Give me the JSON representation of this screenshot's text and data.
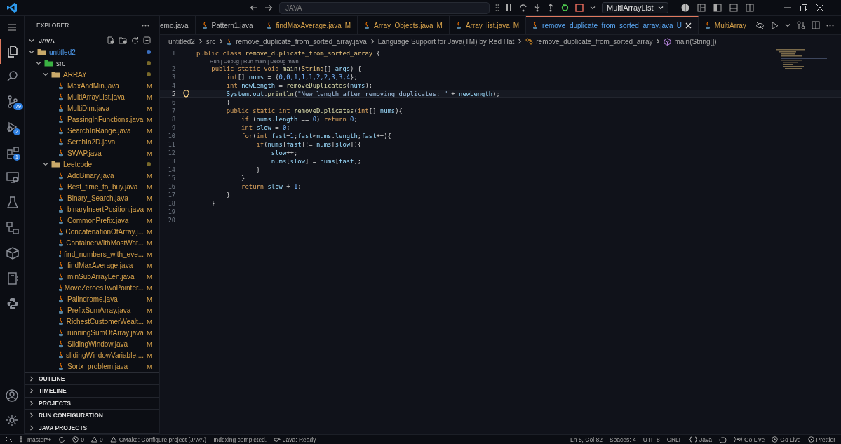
{
  "title_bar": {
    "search": "JAVA",
    "run_target": "MultiArrayList"
  },
  "activity_bar": [
    {
      "kind": "files",
      "selected": true
    },
    {
      "kind": "search",
      "selected": false
    },
    {
      "kind": "source-control",
      "selected": false,
      "badge": "79"
    },
    {
      "kind": "run-debug",
      "selected": false,
      "badge": "2"
    },
    {
      "kind": "extensions",
      "selected": false,
      "badge": "1"
    },
    {
      "kind": "remote",
      "selected": false
    },
    {
      "kind": "testing",
      "selected": false
    },
    {
      "kind": "diagram",
      "selected": false
    },
    {
      "kind": "package",
      "selected": false
    },
    {
      "kind": "book",
      "selected": false
    },
    {
      "kind": "python",
      "selected": false
    }
  ],
  "explorer": {
    "title": "EXPLORER",
    "section": "JAVA",
    "tree": [
      {
        "name": "untitled2",
        "kind": "folder",
        "untracked": true,
        "modified": false,
        "expanded": true,
        "children": [
          {
            "name": "src",
            "kind": "package",
            "untracked": false,
            "modified": false,
            "expanded": true,
            "children": [
              {
                "name": "ARRAY",
                "kind": "folder",
                "untracked": false,
                "modified": true,
                "expanded": true,
                "children": [
                  {
                    "name": "MaxAndMin.java",
                    "kind": "file",
                    "untracked": false,
                    "modified": true,
                    "badge": "M"
                  },
                  {
                    "name": "MultiArrayList.java",
                    "kind": "file",
                    "untracked": false,
                    "modified": true,
                    "badge": "M"
                  },
                  {
                    "name": "MultiDim.java",
                    "kind": "file",
                    "untracked": false,
                    "modified": true,
                    "badge": "M"
                  },
                  {
                    "name": "PassingInFunctions.java",
                    "kind": "file",
                    "untracked": false,
                    "modified": true,
                    "badge": "M"
                  },
                  {
                    "name": "SearchInRange.java",
                    "kind": "file",
                    "untracked": false,
                    "modified": true,
                    "badge": "M"
                  },
                  {
                    "name": "SerchIn2D.java",
                    "kind": "file",
                    "untracked": false,
                    "modified": true,
                    "badge": "M"
                  },
                  {
                    "name": "SWAP.java",
                    "kind": "file",
                    "untracked": false,
                    "modified": true,
                    "badge": "M"
                  }
                ]
              },
              {
                "name": "Leetcode",
                "kind": "folder",
                "untracked": false,
                "modified": true,
                "expanded": true,
                "children": [
                  {
                    "name": "AddBinary.java",
                    "kind": "file",
                    "untracked": false,
                    "modified": true,
                    "badge": "M"
                  },
                  {
                    "name": "Best_time_to_buy.java",
                    "kind": "file",
                    "untracked": false,
                    "modified": true,
                    "badge": "M"
                  },
                  {
                    "name": "Binary_Search.java",
                    "kind": "file",
                    "untracked": false,
                    "modified": true,
                    "badge": "M"
                  },
                  {
                    "name": "binaryInsertPosition.java",
                    "kind": "file",
                    "untracked": false,
                    "modified": true,
                    "badge": "M"
                  },
                  {
                    "name": "CommonPrefix.java",
                    "kind": "file",
                    "untracked": false,
                    "modified": true,
                    "badge": "M"
                  },
                  {
                    "name": "ConcatenationOfArray.j...",
                    "kind": "file",
                    "untracked": false,
                    "modified": true,
                    "badge": "M"
                  },
                  {
                    "name": "ContainerWithMostWat...",
                    "kind": "file",
                    "untracked": false,
                    "modified": true,
                    "badge": "M"
                  },
                  {
                    "name": "find_numbers_with_eve...",
                    "kind": "file",
                    "untracked": false,
                    "modified": true,
                    "badge": "M"
                  },
                  {
                    "name": "findMaxAverage.java",
                    "kind": "file",
                    "untracked": false,
                    "modified": true,
                    "badge": "M"
                  },
                  {
                    "name": "minSubArrayLen.java",
                    "kind": "file",
                    "untracked": false,
                    "modified": true,
                    "badge": "M"
                  },
                  {
                    "name": "MoveZeroesTwoPointer...",
                    "kind": "file",
                    "untracked": false,
                    "modified": true,
                    "badge": "M"
                  },
                  {
                    "name": "Palindrome.java",
                    "kind": "file",
                    "untracked": false,
                    "modified": true,
                    "badge": "M"
                  },
                  {
                    "name": "PrefixSumArray.java",
                    "kind": "file",
                    "untracked": false,
                    "modified": true,
                    "badge": "M"
                  },
                  {
                    "name": "RichestCustomerWealt...",
                    "kind": "file",
                    "untracked": false,
                    "modified": true,
                    "badge": "M"
                  },
                  {
                    "name": "runningSumOfArray.java",
                    "kind": "file",
                    "untracked": false,
                    "modified": true,
                    "badge": "M"
                  },
                  {
                    "name": "SlidingWindow.java",
                    "kind": "file",
                    "untracked": false,
                    "modified": true,
                    "badge": "M"
                  },
                  {
                    "name": "slidingWindowVariable....",
                    "kind": "file",
                    "untracked": false,
                    "modified": true,
                    "badge": "M"
                  },
                  {
                    "name": "Sortx_problem.java",
                    "kind": "file",
                    "untracked": false,
                    "modified": true,
                    "badge": "M"
                  }
                ]
              }
            ]
          }
        ]
      }
    ]
  },
  "panels": [
    "OUTLINE",
    "TIMELINE",
    "PROJECTS",
    "RUN CONFIGURATION",
    "JAVA PROJECTS"
  ],
  "tabs": [
    {
      "label": "emo.java",
      "modified": false,
      "selected": false
    },
    {
      "label": "Pattern1.java",
      "modified": false,
      "selected": false
    },
    {
      "label": "findMaxAverage.java",
      "modified": true,
      "badge": "M",
      "selected": false
    },
    {
      "label": "Array_Objects.java",
      "modified": true,
      "badge": "M",
      "selected": false
    },
    {
      "label": "Array_list.java",
      "modified": true,
      "badge": "M",
      "selected": false
    },
    {
      "label": "remove_duplicate_from_sorted_array.java",
      "modified": false,
      "badge": "U",
      "selected": true
    },
    {
      "label": "MultiArray",
      "modified": true,
      "selected": false
    }
  ],
  "breadcrumbs": [
    {
      "text": "untitled2",
      "kind": "folder"
    },
    {
      "text": "src",
      "kind": "folder"
    },
    {
      "text": "remove_duplicate_from_sorted_array.java",
      "kind": "file"
    },
    {
      "text": "Language Support for Java(TM) by Red Hat",
      "kind": "folder"
    },
    {
      "text": "remove_duplicate_from_sorted_array",
      "kind": "class"
    },
    {
      "text": "main(String[])",
      "kind": "method"
    }
  ],
  "editor": {
    "lines": [
      {
        "number": "1",
        "active": false,
        "tokens": [
          {
            "text": "public class ",
            "kind": "kw"
          },
          {
            "text": "remove_duplicate_from_sorted_array",
            "kind": "type"
          },
          {
            "text": " {",
            "kind": "punc"
          }
        ],
        "codelens": "Run | Debug | Run main | Debug main"
      },
      {
        "number": "2",
        "active": false,
        "tokens": [
          {
            "text": "    public static void ",
            "kind": "kw"
          },
          {
            "text": "main",
            "kind": "fn"
          },
          {
            "text": "(",
            "kind": "punc"
          },
          {
            "text": "String",
            "kind": "type"
          },
          {
            "text": "[] ",
            "kind": "punc"
          },
          {
            "text": "args",
            "kind": "var"
          },
          {
            "text": ") {",
            "kind": "punc"
          }
        ]
      },
      {
        "number": "3",
        "active": false,
        "tokens": [
          {
            "text": "        int",
            "kind": "kw"
          },
          {
            "text": "[] ",
            "kind": "punc"
          },
          {
            "text": "nums",
            "kind": "var"
          },
          {
            "text": " = {",
            "kind": "punc"
          },
          {
            "text": "0,0,1,1,1,2,2,3,3,4",
            "kind": "num"
          },
          {
            "text": "};",
            "kind": "punc"
          }
        ]
      },
      {
        "number": "4",
        "active": false,
        "tokens": [
          {
            "text": "        int ",
            "kind": "kw"
          },
          {
            "text": "newLength",
            "kind": "var"
          },
          {
            "text": " = ",
            "kind": "punc"
          },
          {
            "text": "removeDuplicates",
            "kind": "fn"
          },
          {
            "text": "(",
            "kind": "punc"
          },
          {
            "text": "nums",
            "kind": "var"
          },
          {
            "text": ");",
            "kind": "punc"
          }
        ]
      },
      {
        "number": "5",
        "active": true,
        "lightbulb": true,
        "tokens": [
          {
            "text": "        System",
            "kind": "var"
          },
          {
            "text": ".",
            "kind": "punc"
          },
          {
            "text": "out",
            "kind": "var"
          },
          {
            "text": ".",
            "kind": "punc"
          },
          {
            "text": "println",
            "kind": "fn"
          },
          {
            "text": "(",
            "kind": "punc"
          },
          {
            "text": "\"New length after removing duplicates: \"",
            "kind": "str"
          },
          {
            "text": " + ",
            "kind": "punc"
          },
          {
            "text": "newLength",
            "kind": "var"
          },
          {
            "text": ");",
            "kind": "punc"
          }
        ]
      },
      {
        "number": "6",
        "active": false,
        "tokens": [
          {
            "text": "        }",
            "kind": "punc"
          }
        ]
      },
      {
        "number": "7",
        "active": false,
        "tokens": [
          {
            "text": "        public static int ",
            "kind": "kw"
          },
          {
            "text": "removeDuplicates",
            "kind": "fn"
          },
          {
            "text": "(",
            "kind": "punc"
          },
          {
            "text": "int",
            "kind": "kw"
          },
          {
            "text": "[] ",
            "kind": "punc"
          },
          {
            "text": "nums",
            "kind": "var"
          },
          {
            "text": "){",
            "kind": "punc"
          }
        ]
      },
      {
        "number": "8",
        "active": false,
        "tokens": [
          {
            "text": "            if ",
            "kind": "kw"
          },
          {
            "text": "(",
            "kind": "punc"
          },
          {
            "text": "nums",
            "kind": "var"
          },
          {
            "text": ".",
            "kind": "punc"
          },
          {
            "text": "length",
            "kind": "var"
          },
          {
            "text": " == ",
            "kind": "punc"
          },
          {
            "text": "0",
            "kind": "num"
          },
          {
            "text": ") ",
            "kind": "punc"
          },
          {
            "text": "return ",
            "kind": "kw"
          },
          {
            "text": "0",
            "kind": "num"
          },
          {
            "text": ";",
            "kind": "punc"
          }
        ]
      },
      {
        "number": "9",
        "active": false,
        "tokens": [
          {
            "text": "            int ",
            "kind": "kw"
          },
          {
            "text": "slow",
            "kind": "var"
          },
          {
            "text": " = ",
            "kind": "punc"
          },
          {
            "text": "0",
            "kind": "num"
          },
          {
            "text": ";",
            "kind": "punc"
          }
        ]
      },
      {
        "number": "10",
        "active": false,
        "tokens": [
          {
            "text": "            for",
            "kind": "kw"
          },
          {
            "text": "(",
            "kind": "punc"
          },
          {
            "text": "int ",
            "kind": "kw"
          },
          {
            "text": "fast",
            "kind": "var"
          },
          {
            "text": "=",
            "kind": "punc"
          },
          {
            "text": "1",
            "kind": "num"
          },
          {
            "text": ";",
            "kind": "punc"
          },
          {
            "text": "fast",
            "kind": "var"
          },
          {
            "text": "<",
            "kind": "punc"
          },
          {
            "text": "nums",
            "kind": "var"
          },
          {
            "text": ".",
            "kind": "punc"
          },
          {
            "text": "length",
            "kind": "var"
          },
          {
            "text": ";",
            "kind": "punc"
          },
          {
            "text": "fast",
            "kind": "var"
          },
          {
            "text": "++){",
            "kind": "punc"
          }
        ]
      },
      {
        "number": "11",
        "active": false,
        "tokens": [
          {
            "text": "                if",
            "kind": "kw"
          },
          {
            "text": "(",
            "kind": "punc"
          },
          {
            "text": "nums",
            "kind": "var"
          },
          {
            "text": "[",
            "kind": "punc"
          },
          {
            "text": "fast",
            "kind": "var"
          },
          {
            "text": "]!= ",
            "kind": "punc"
          },
          {
            "text": "nums",
            "kind": "var"
          },
          {
            "text": "[",
            "kind": "punc"
          },
          {
            "text": "slow",
            "kind": "var"
          },
          {
            "text": "]){",
            "kind": "punc"
          }
        ]
      },
      {
        "number": "12",
        "active": false,
        "tokens": [
          {
            "text": "                    slow",
            "kind": "var"
          },
          {
            "text": "++;",
            "kind": "punc"
          }
        ]
      },
      {
        "number": "13",
        "active": false,
        "tokens": [
          {
            "text": "                    nums",
            "kind": "var"
          },
          {
            "text": "[",
            "kind": "punc"
          },
          {
            "text": "slow",
            "kind": "var"
          },
          {
            "text": "] = ",
            "kind": "punc"
          },
          {
            "text": "nums",
            "kind": "var"
          },
          {
            "text": "[",
            "kind": "punc"
          },
          {
            "text": "fast",
            "kind": "var"
          },
          {
            "text": "];",
            "kind": "punc"
          }
        ]
      },
      {
        "number": "14",
        "active": false,
        "tokens": [
          {
            "text": "                }",
            "kind": "punc"
          }
        ]
      },
      {
        "number": "15",
        "active": false,
        "tokens": [
          {
            "text": "            }",
            "kind": "punc"
          }
        ]
      },
      {
        "number": "16",
        "active": false,
        "tokens": [
          {
            "text": "            return ",
            "kind": "kw"
          },
          {
            "text": "slow",
            "kind": "var"
          },
          {
            "text": " + ",
            "kind": "punc"
          },
          {
            "text": "1",
            "kind": "num"
          },
          {
            "text": ";",
            "kind": "punc"
          }
        ]
      },
      {
        "number": "17",
        "active": false,
        "tokens": [
          {
            "text": "        }",
            "kind": "punc"
          }
        ]
      },
      {
        "number": "18",
        "active": false,
        "tokens": [
          {
            "text": "    }",
            "kind": "punc"
          }
        ]
      },
      {
        "number": "19",
        "active": false
      },
      {
        "number": "20",
        "active": false
      }
    ]
  },
  "status_bar": {
    "left": [
      {
        "kind": "remote"
      },
      {
        "kind": "branch",
        "text": "master*+"
      },
      {
        "kind": "sync"
      },
      {
        "kind": "errors",
        "text": "0"
      },
      {
        "kind": "warnings",
        "text": "0"
      },
      {
        "kind": "cmake",
        "text": "CMake: Configure project (JAVA)"
      },
      {
        "kind": "plain",
        "text": "Indexing completed."
      },
      {
        "kind": "java",
        "text": "Java: Ready"
      }
    ],
    "right": [
      {
        "kind": "plain",
        "text": "Ln 5, Col 82"
      },
      {
        "kind": "plain",
        "text": "Spaces: 4"
      },
      {
        "kind": "plain",
        "text": "UTF-8"
      },
      {
        "kind": "plain",
        "text": "CRLF"
      },
      {
        "kind": "braces",
        "text": "Java"
      },
      {
        "kind": "copilot"
      },
      {
        "kind": "broadcast",
        "text": "Go Live"
      },
      {
        "kind": "play",
        "text": "Go Live"
      },
      {
        "kind": "check",
        "text": "Prettier"
      }
    ]
  }
}
